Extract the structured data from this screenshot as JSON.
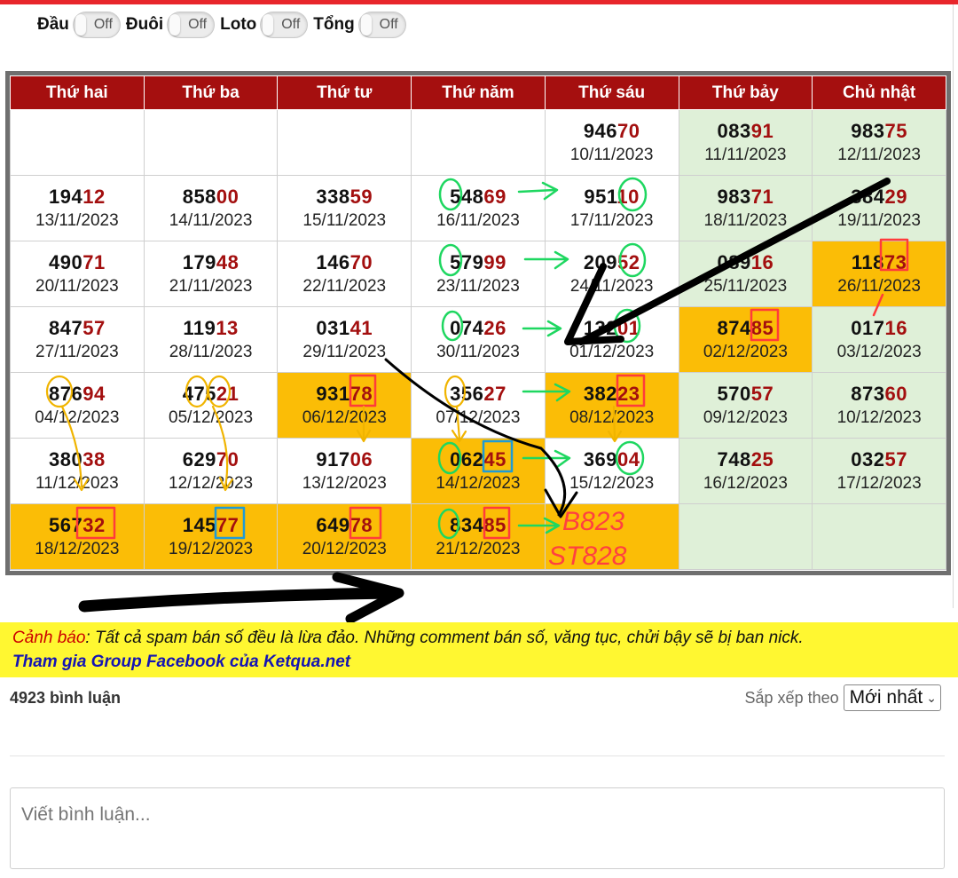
{
  "toggles": [
    {
      "label": "Đầu",
      "state": "Off"
    },
    {
      "label": "Đuôi",
      "state": "Off"
    },
    {
      "label": "Loto",
      "state": "Off"
    },
    {
      "label": "Tổng",
      "state": "Off"
    }
  ],
  "calendar": {
    "headers": [
      "Thứ hai",
      "Thứ ba",
      "Thứ tư",
      "Thứ năm",
      "Thứ sáu",
      "Thứ bảy",
      "Chủ nhật"
    ],
    "rows": [
      [
        {
          "head": "",
          "tail": "",
          "date": ""
        },
        {
          "head": "",
          "tail": "",
          "date": ""
        },
        {
          "head": "",
          "tail": "",
          "date": ""
        },
        {
          "head": "",
          "tail": "",
          "date": ""
        },
        {
          "head": "946",
          "tail": "70",
          "date": "10/11/2023"
        },
        {
          "head": "083",
          "tail": "91",
          "date": "11/11/2023"
        },
        {
          "head": "983",
          "tail": "75",
          "date": "12/11/2023"
        }
      ],
      [
        {
          "head": "194",
          "tail": "12",
          "date": "13/11/2023"
        },
        {
          "head": "858",
          "tail": "00",
          "date": "14/11/2023"
        },
        {
          "head": "338",
          "tail": "59",
          "date": "15/11/2023"
        },
        {
          "head": "548",
          "tail": "69",
          "date": "16/11/2023"
        },
        {
          "head": "951",
          "tail": "10",
          "date": "17/11/2023"
        },
        {
          "head": "983",
          "tail": "71",
          "date": "18/11/2023"
        },
        {
          "head": "384",
          "tail": "29",
          "date": "19/11/2023"
        }
      ],
      [
        {
          "head": "490",
          "tail": "71",
          "date": "20/11/2023"
        },
        {
          "head": "179",
          "tail": "48",
          "date": "21/11/2023"
        },
        {
          "head": "146",
          "tail": "70",
          "date": "22/11/2023"
        },
        {
          "head": "579",
          "tail": "99",
          "date": "23/11/2023"
        },
        {
          "head": "209",
          "tail": "52",
          "date": "24/11/2023"
        },
        {
          "head": "089",
          "tail": "16",
          "date": "25/11/2023"
        },
        {
          "head": "118",
          "tail": "73",
          "date": "26/11/2023"
        }
      ],
      [
        {
          "head": "847",
          "tail": "57",
          "date": "27/11/2023"
        },
        {
          "head": "119",
          "tail": "13",
          "date": "28/11/2023"
        },
        {
          "head": "031",
          "tail": "41",
          "date": "29/11/2023"
        },
        {
          "head": "074",
          "tail": "26",
          "date": "30/11/2023"
        },
        {
          "head": "132",
          "tail": "01",
          "date": "01/12/2023"
        },
        {
          "head": "874",
          "tail": "85",
          "date": "02/12/2023"
        },
        {
          "head": "017",
          "tail": "16",
          "date": "03/12/2023"
        }
      ],
      [
        {
          "head": "876",
          "tail": "94",
          "date": "04/12/2023"
        },
        {
          "head": "475",
          "tail": "21",
          "date": "05/12/2023"
        },
        {
          "head": "931",
          "tail": "78",
          "date": "06/12/2023"
        },
        {
          "head": "356",
          "tail": "27",
          "date": "07/12/2023"
        },
        {
          "head": "382",
          "tail": "23",
          "date": "08/12/2023"
        },
        {
          "head": "570",
          "tail": "57",
          "date": "09/12/2023"
        },
        {
          "head": "873",
          "tail": "60",
          "date": "10/12/2023"
        }
      ],
      [
        {
          "head": "380",
          "tail": "38",
          "date": "11/12/2023"
        },
        {
          "head": "629",
          "tail": "70",
          "date": "12/12/2023"
        },
        {
          "head": "917",
          "tail": "06",
          "date": "13/12/2023"
        },
        {
          "head": "062",
          "tail": "45",
          "date": "14/12/2023"
        },
        {
          "head": "369",
          "tail": "04",
          "date": "15/12/2023"
        },
        {
          "head": "748",
          "tail": "25",
          "date": "16/12/2023"
        },
        {
          "head": "032",
          "tail": "57",
          "date": "17/12/2023"
        }
      ],
      [
        {
          "head": "567",
          "tail": "32",
          "date": "18/12/2023"
        },
        {
          "head": "145",
          "tail": "77",
          "date": "19/12/2023"
        },
        {
          "head": "649",
          "tail": "78",
          "date": "20/12/2023"
        },
        {
          "head": "834",
          "tail": "85",
          "date": "21/12/2023"
        },
        {
          "head": "",
          "tail": "",
          "date": ""
        },
        {
          "head": "",
          "tail": "",
          "date": ""
        },
        {
          "head": "",
          "tail": "",
          "date": ""
        }
      ]
    ],
    "highlighted": [
      "2-6",
      "3-5",
      "4-2",
      "4-4",
      "5-3",
      "6-0",
      "6-1",
      "6-2",
      "6-3",
      "6-4"
    ]
  },
  "handwriting": {
    "note1": "B823",
    "note2": "ST828"
  },
  "warning": {
    "label": "Cảnh báo",
    "text": ": Tất cả spam bán số đều là lừa đảo. Những comment bán số, văng tục, chửi bậy sẽ bị ban nick.",
    "link": "Tham gia Group Facebook của Ketqua.net"
  },
  "comments": {
    "count": "4923 bình luận",
    "sort_label": "Sắp xếp theo",
    "sort_value": "Mới nhất",
    "placeholder": "Viết bình luận..."
  },
  "colors": {
    "header_bg": "#a50f0f",
    "weekend_bg": "#dff0d8",
    "highlight_bg": "#fbbd06",
    "warning_bg": "#fff731",
    "number_tail": "#a30f0f"
  }
}
